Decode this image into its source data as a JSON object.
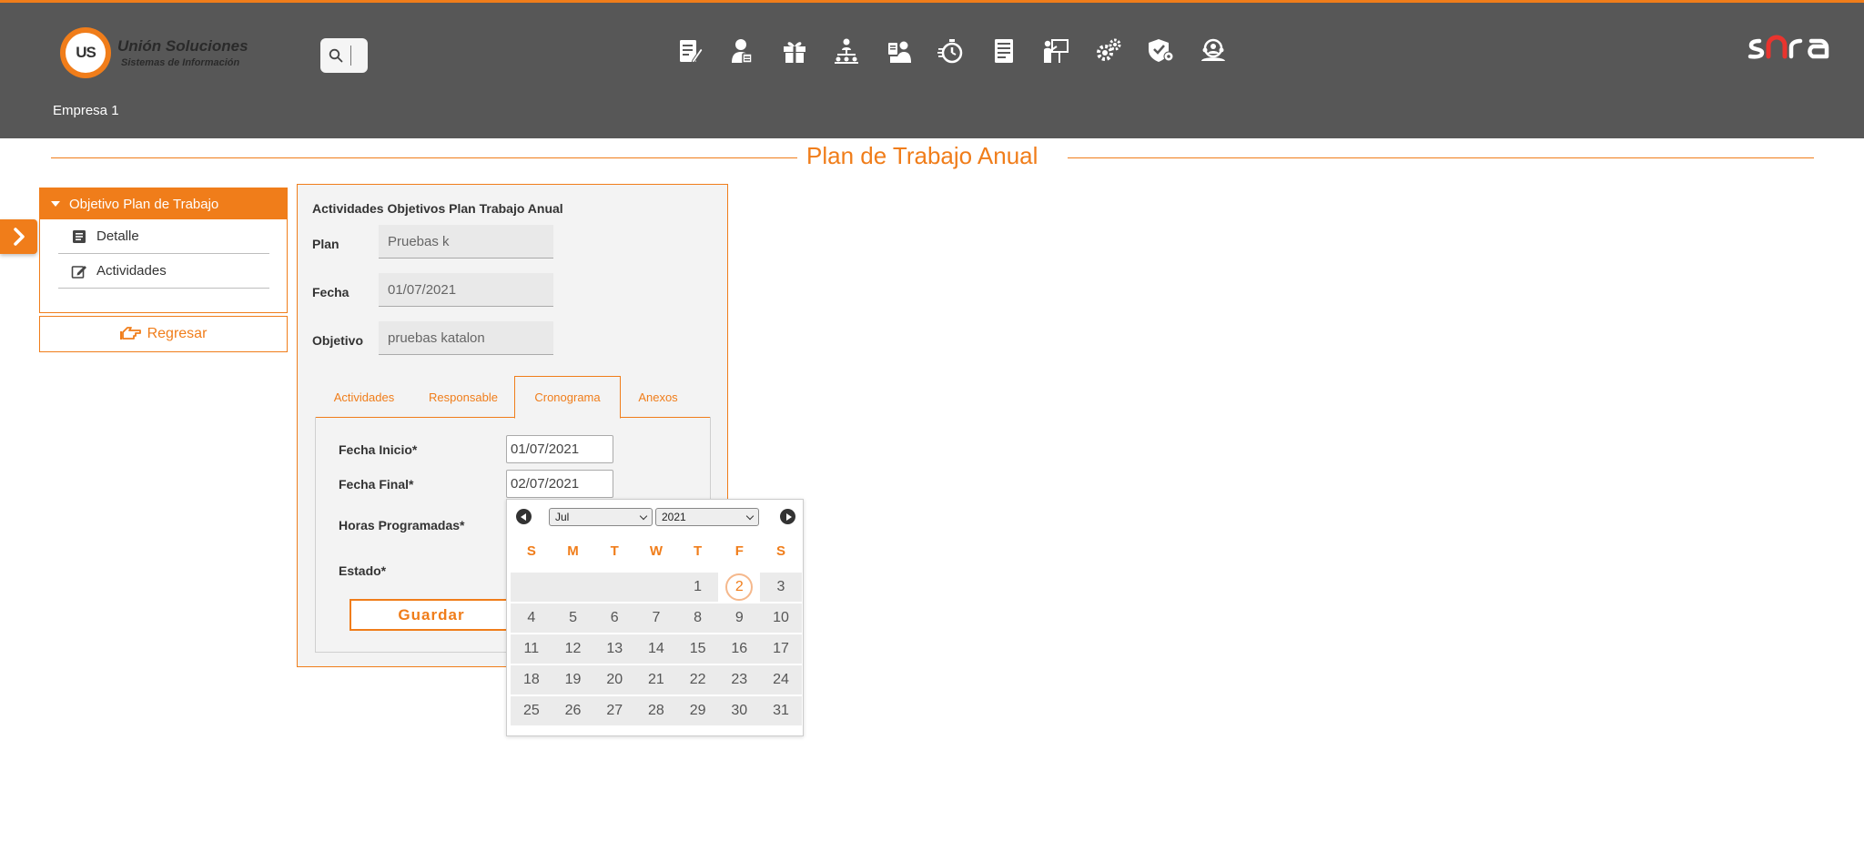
{
  "header": {
    "logo_mark": "UNION US",
    "logo_title": "Unión Soluciones",
    "logo_subtitle": "Sistemas de Información",
    "search_placeholder": "",
    "nav_icons": [
      "document-edit-icon",
      "user-profile-icon",
      "gift-icon",
      "org-hierarchy-icon",
      "workers-icon",
      "stopwatch-icon",
      "report-list-icon",
      "presentation-icon",
      "gears-icon",
      "shield-location-icon",
      "people-search-icon"
    ],
    "brand": "sora",
    "company": "Empresa 1"
  },
  "page": {
    "title": "Plan de Trabajo Anual"
  },
  "sidebar": {
    "section_title": "Objetivo Plan de Trabajo",
    "items": [
      {
        "label": "Detalle",
        "icon": "list-icon"
      },
      {
        "label": "Actividades",
        "icon": "edit-icon"
      }
    ],
    "back_label": "Regresar"
  },
  "form": {
    "heading": "Actividades Objetivos Plan Trabajo Anual",
    "fields": [
      {
        "label": "Plan",
        "value": "Pruebas  k"
      },
      {
        "label": "Fecha",
        "value": "01/07/2021"
      },
      {
        "label": "Objetivo",
        "value": "pruebas katalon"
      }
    ],
    "tabs": [
      "Actividades",
      "Responsable",
      "Cronograma",
      "Anexos"
    ],
    "active_tab": "Cronograma",
    "cronograma": {
      "start_label": "Fecha Inicio*",
      "start_value": "01/07/2021",
      "end_label": "Fecha Final*",
      "end_value": "02/07/2021",
      "hours_label": "Horas Programadas*",
      "status_label": "Estado*",
      "save_label": "Guardar"
    }
  },
  "datepicker": {
    "month": "Jul",
    "year": "2021",
    "weekdays": [
      "S",
      "M",
      "T",
      "W",
      "T",
      "F",
      "S"
    ],
    "leading_blanks": 4,
    "days_in_month": 31,
    "selected_day": 2
  },
  "colors": {
    "accent": "#f07d1a",
    "header_bg": "#575757",
    "panel_bg": "#f3f3f3"
  }
}
